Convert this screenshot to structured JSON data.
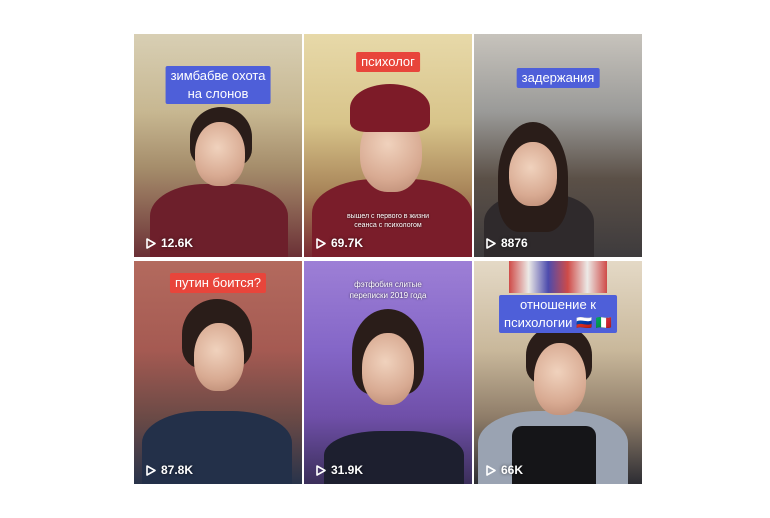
{
  "tiles": [
    {
      "caption": [
        "зимбабве охота",
        "на слонов"
      ],
      "views": "12.6K"
    },
    {
      "caption": [
        "психолог"
      ],
      "views": "69.7K",
      "overlay": [
        "вышел с первого в жизни",
        "сеанса с психологом"
      ]
    },
    {
      "caption": [
        "задержания"
      ],
      "views": "8876"
    },
    {
      "caption": [
        "путин боится?"
      ],
      "views": "87.8K"
    },
    {
      "caption": [],
      "views": "31.9K",
      "overlay": [
        "фэтфобия слитые",
        "переписки 2019 года"
      ]
    },
    {
      "caption": [
        "отношение к",
        "психологии 🇷🇺 🇮🇹"
      ],
      "views": "66K"
    }
  ],
  "colors": {
    "banner_blue": "#4e5fd9",
    "banner_red": "#e8453b"
  },
  "icons": {
    "views": "play-icon"
  }
}
